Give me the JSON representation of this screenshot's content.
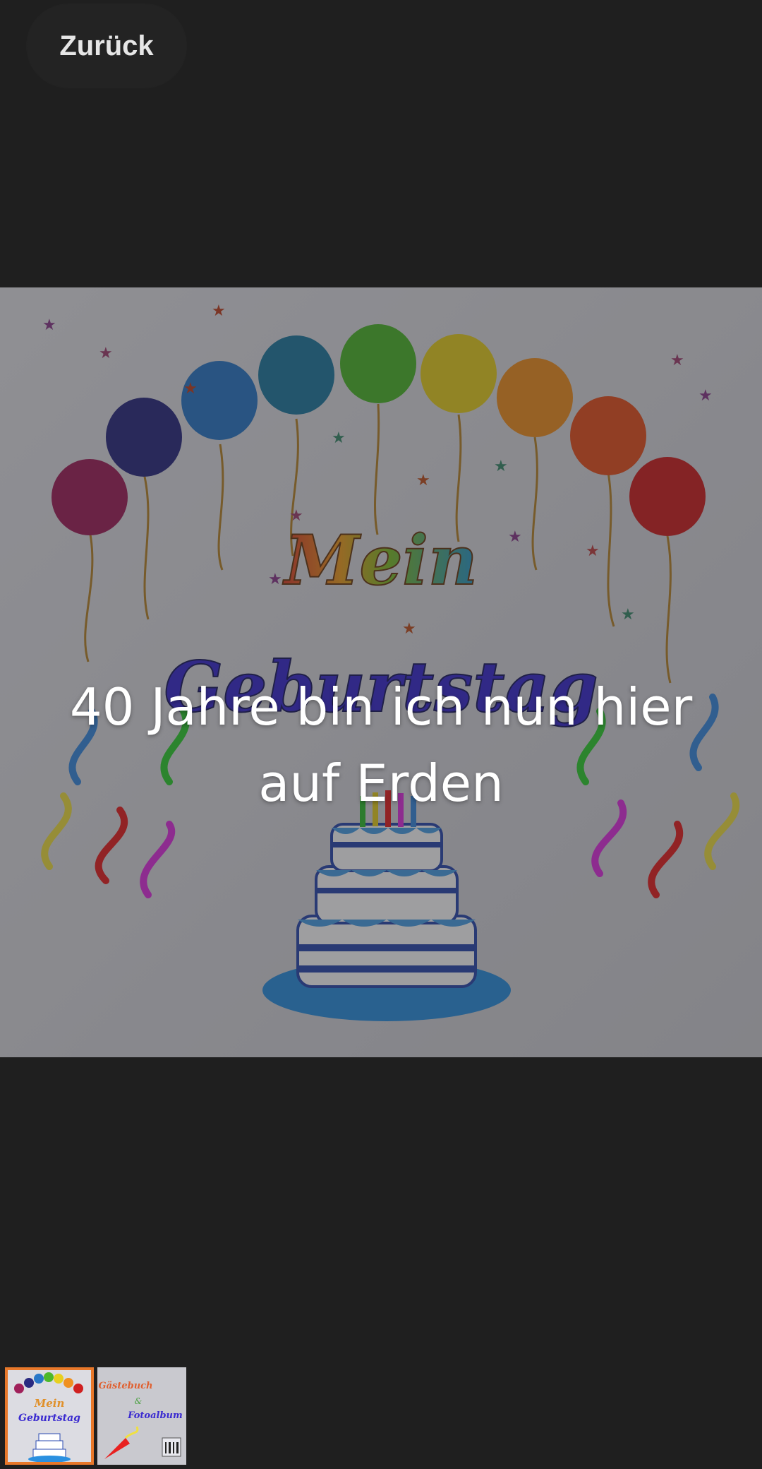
{
  "header": {
    "back_label": "Zurück"
  },
  "viewer": {
    "caption": "40 Jahre bin ich nun hier auf Erden",
    "image_title_line1": "Mein",
    "image_title_line2": "Geburtstag"
  },
  "thumbnails": [
    {
      "title_line1": "Mein",
      "title_line2": "Geburtstag",
      "selected": true
    },
    {
      "title_line1": "Gästebuch",
      "title_line2": "&",
      "title_line3": "Fotoalbum",
      "selected": false
    }
  ],
  "colors": {
    "background": "#1f1f1f",
    "selection": "#e8782a",
    "caption_text": "#ffffff"
  }
}
